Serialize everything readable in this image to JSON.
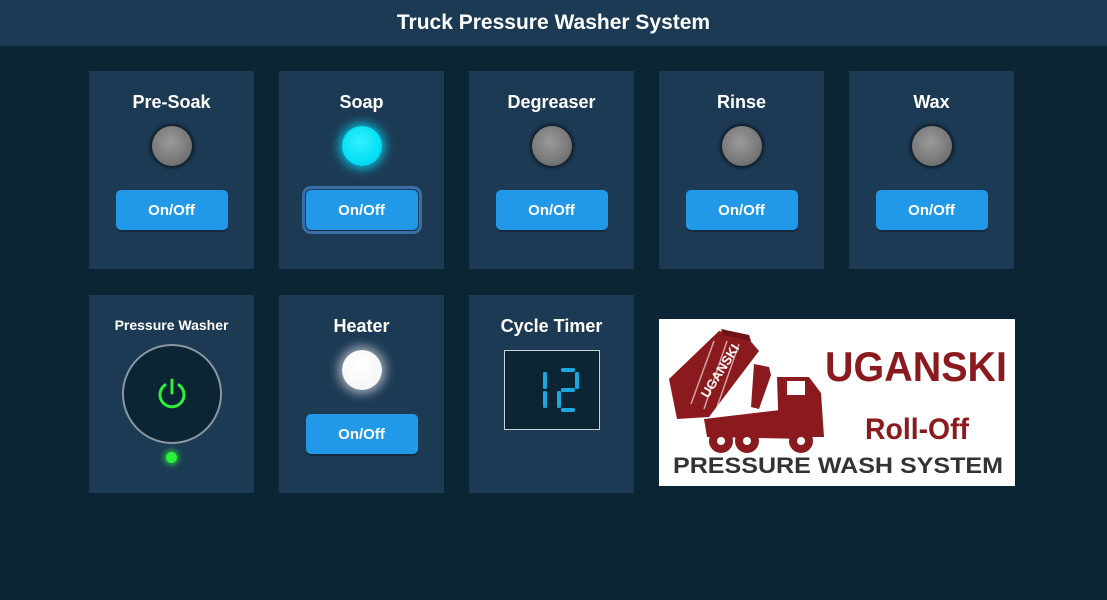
{
  "header": {
    "title": "Truck Pressure Washer System"
  },
  "stations": [
    {
      "label": "Pre-Soak",
      "state": "off",
      "button_label": "On/Off"
    },
    {
      "label": "Soap",
      "state": "on",
      "button_label": "On/Off"
    },
    {
      "label": "Degreaser",
      "state": "off",
      "button_label": "On/Off"
    },
    {
      "label": "Rinse",
      "state": "off",
      "button_label": "On/Off"
    },
    {
      "label": "Wax",
      "state": "off",
      "button_label": "On/Off"
    }
  ],
  "pressure_washer": {
    "label": "Pressure Washer",
    "icon": "power-icon",
    "state": "on"
  },
  "heater": {
    "label": "Heater",
    "state": "on",
    "button_label": "On/Off"
  },
  "cycle_timer": {
    "label": "Cycle Timer",
    "value": "12"
  },
  "logo": {
    "line1": "UGANSKI",
    "line2": "Roll-Off",
    "line3": "PRESSURE WASH SYSTEM",
    "truck_text": "UGANSKI"
  },
  "colors": {
    "background": "#0b2535",
    "panel": "#1d3a54",
    "button": "#2199e8",
    "lamp_off": "#7b7b7b",
    "lamp_soap_on": "#05e0f5",
    "led_on": "#2cf03c",
    "digit": "#1aa8e0",
    "logo_red": "#8b1a1f"
  }
}
